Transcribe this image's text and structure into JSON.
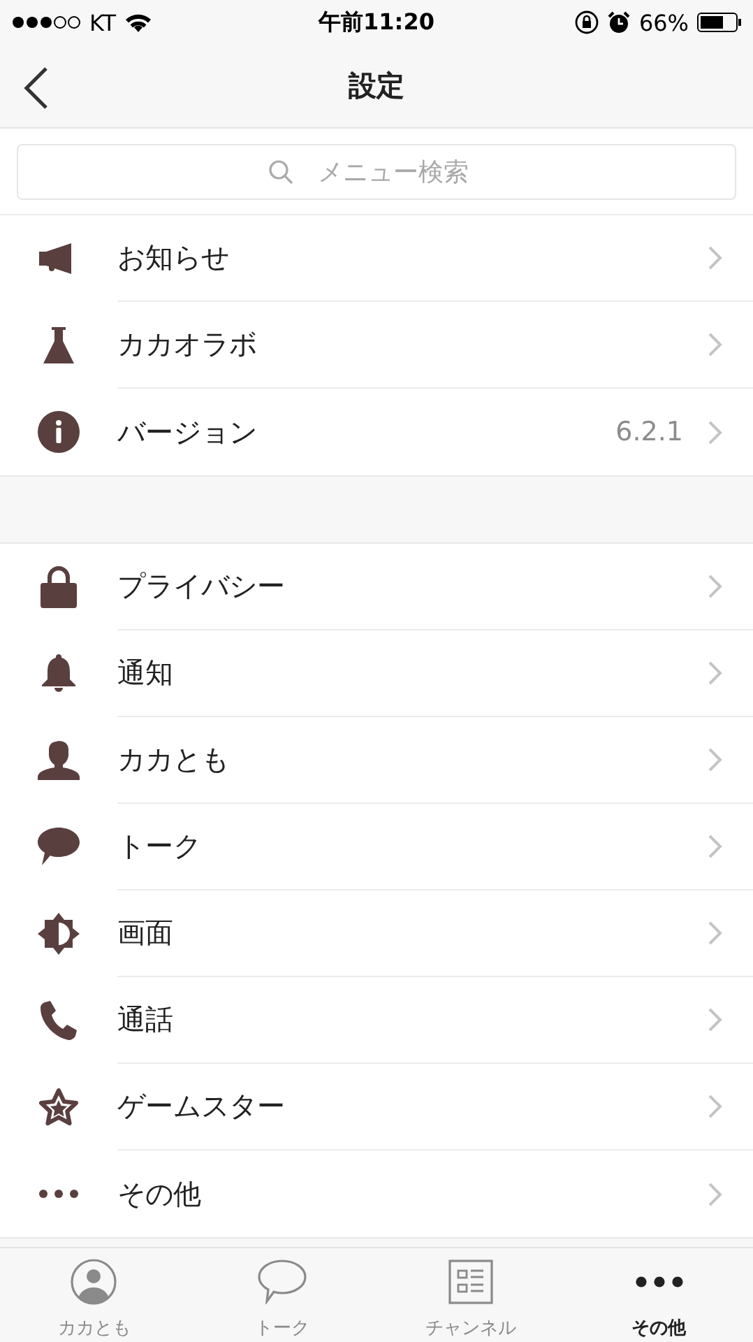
{
  "status_bar": {
    "carrier": "KT",
    "time": "午前11:20",
    "battery": "66%"
  },
  "nav_bar": {
    "title": "設定"
  },
  "search": {
    "placeholder": "メニュー検索"
  },
  "groups": [
    {
      "rows": [
        {
          "kind": "megaphone",
          "label": "お知らせ"
        },
        {
          "kind": "flask",
          "label": "カカオラボ"
        },
        {
          "kind": "info",
          "label": "バージョン",
          "value": "6.2.1"
        }
      ]
    },
    {
      "rows": [
        {
          "kind": "lock",
          "label": "プライバシー"
        },
        {
          "kind": "bell",
          "label": "通知"
        },
        {
          "kind": "person",
          "label": "カカとも"
        },
        {
          "kind": "bubble",
          "label": "トーク"
        },
        {
          "kind": "brightness",
          "label": "画面"
        },
        {
          "kind": "phone",
          "label": "通話"
        },
        {
          "kind": "star",
          "label": "ゲームスター"
        },
        {
          "kind": "dots",
          "label": "その他"
        }
      ]
    }
  ],
  "tab_bar": [
    {
      "kind": "friends",
      "label": "カカとも",
      "selected": false
    },
    {
      "kind": "chat",
      "label": "トーク",
      "selected": false
    },
    {
      "kind": "channel",
      "label": "チャンネル",
      "selected": false
    },
    {
      "kind": "more",
      "label": "その他",
      "selected": true
    }
  ]
}
